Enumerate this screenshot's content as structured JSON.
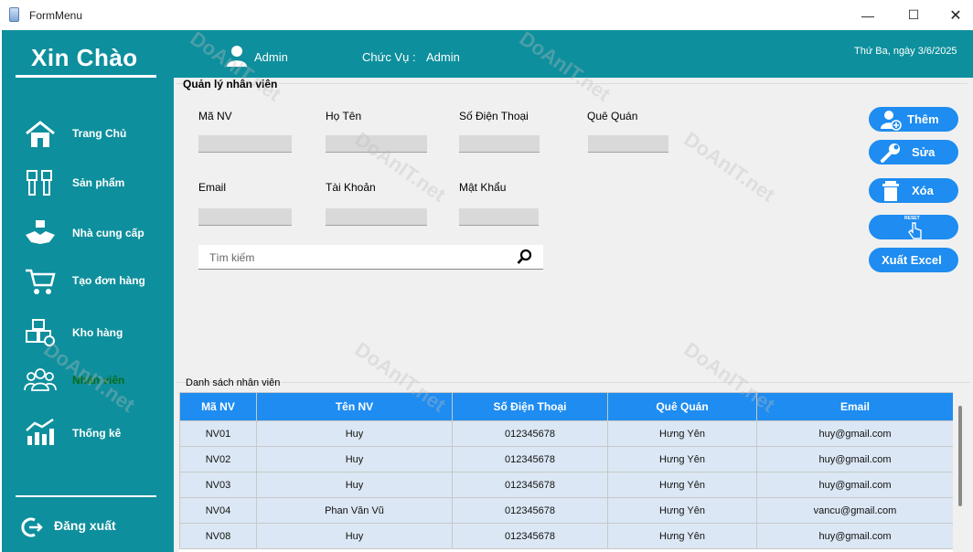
{
  "window": {
    "title": "FormMenu",
    "minimize": "—",
    "maximize": "☐",
    "close": "✕"
  },
  "header": {
    "greeting": "Xin Chào",
    "user": "Admin",
    "role_label": "Chức Vụ :",
    "role_value": "Admin",
    "date": "Thứ Ba, ngày 3/6/2025"
  },
  "sidebar": {
    "items": [
      {
        "label": "Trang Chủ",
        "icon": "home-icon"
      },
      {
        "label": "Sản phẩm",
        "icon": "usb-icon"
      },
      {
        "label": "Nhà cung cấp",
        "icon": "handshake-icon"
      },
      {
        "label": "Tạo đơn hàng",
        "icon": "cart-icon"
      },
      {
        "label": "Kho hàng",
        "icon": "boxes-icon"
      },
      {
        "label": "Nhân viên",
        "icon": "people-icon"
      },
      {
        "label": "Thống kê",
        "icon": "chart-icon"
      }
    ],
    "logout": "Đăng xuất"
  },
  "form": {
    "title": "Quản lý nhân viên",
    "fields": {
      "ma_nv": "Mã NV",
      "ho_ten": "Họ Tên",
      "sdt": "Số Điện Thoại",
      "que_quan": "Quê Quán",
      "email": "Email",
      "tai_khoan": "Tài Khoản",
      "mat_khau": "Mật Khẩu"
    },
    "search_placeholder": "Tìm kiếm"
  },
  "actions": {
    "add": "Thêm",
    "edit": "Sửa",
    "delete": "Xóa",
    "reset": "RESET",
    "export": "Xuất Excel"
  },
  "list": {
    "title": "Danh sách nhân viên",
    "columns": [
      "Mã NV",
      "Tên NV",
      "Số Điện Thoại",
      "Quê Quán",
      "Email"
    ],
    "rows": [
      [
        "NV01",
        "Huy",
        "012345678",
        "Hưng Yên",
        "huy@gmail.com"
      ],
      [
        "NV02",
        "Huy",
        "012345678",
        "Hưng Yên",
        "huy@gmail.com"
      ],
      [
        "NV03",
        "Huy",
        "012345678",
        "Hưng Yên",
        "huy@gmail.com"
      ],
      [
        "NV04",
        "Phan Văn Vũ",
        "012345678",
        "Hưng Yên",
        "vancu@gmail.com"
      ],
      [
        "NV08",
        "Huy",
        "012345678",
        "Hưng Yên",
        "huy@gmail.com"
      ]
    ]
  },
  "watermark": "DoAnIT.net",
  "colors": {
    "teal": "#0e8f9d",
    "blue": "#1e8cf0",
    "active": "#0a6b16"
  }
}
